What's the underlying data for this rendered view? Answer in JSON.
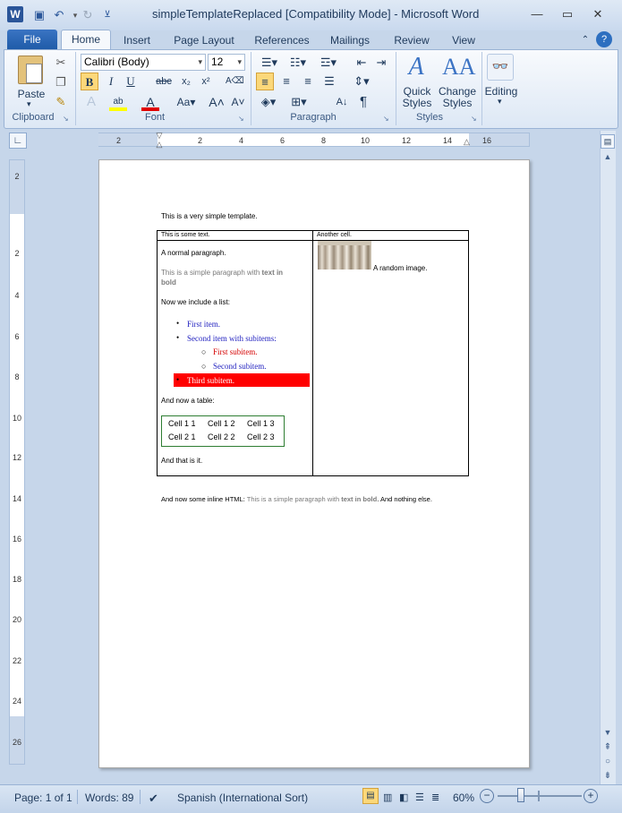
{
  "window": {
    "title": "simpleTemplateReplaced [Compatibility Mode]  -  Microsoft Word",
    "app_icon": "W"
  },
  "tabs": [
    "File",
    "Home",
    "Insert",
    "Page Layout",
    "References",
    "Mailings",
    "Review",
    "View"
  ],
  "ribbon": {
    "clipboard": {
      "paste": "Paste",
      "label": "Clipboard"
    },
    "font": {
      "family": "Calibri (Body)",
      "size": "12",
      "label": "Font"
    },
    "paragraph": {
      "label": "Paragraph"
    },
    "styles": {
      "quick": "Quick",
      "quick2": "Styles",
      "change": "Change",
      "change2": "Styles",
      "label": "Styles"
    },
    "editing": {
      "label": "Editing"
    }
  },
  "ruler": {
    "h_ticks": [
      "2",
      "2",
      "4",
      "6",
      "8",
      "10",
      "12",
      "14",
      "16"
    ],
    "v_ticks": [
      "2",
      "2",
      "4",
      "6",
      "8",
      "10",
      "12",
      "14",
      "16",
      "18",
      "20",
      "22",
      "24",
      "26"
    ]
  },
  "document": {
    "intro": "This is a very simple template.",
    "table": {
      "header_left": "This is some text.",
      "header_right": "Another cell.",
      "normal_paragraph": "A normal paragraph.",
      "simple_para_pre": "This is a simple paragraph with ",
      "simple_para_bold1": "text in",
      "simple_para_bold2": "bold",
      "list_intro": "Now we include a list:",
      "list": {
        "first": "First item.",
        "second": "Second item with subitems:",
        "sub1": "First subitem.",
        "sub2": "Second subitem.",
        "third": "Third subitem."
      },
      "table_intro": "And now a table:",
      "inner_table": [
        [
          "Cell 1 1",
          "Cell 1 2",
          "Cell 1 3"
        ],
        [
          "Cell 2 1",
          "Cell 2 2",
          "Cell 2 3"
        ]
      ],
      "end": "And that is it.",
      "image_caption": "A random image."
    },
    "inline_html": {
      "pre": "And now some inline HTML: ",
      "gray": "This is a simple paragraph with ",
      "bold": "text in bold",
      "post": ".  And nothing else."
    }
  },
  "status": {
    "page": "Page: 1 of 1",
    "words": "Words: 89",
    "language": "Spanish (International Sort)",
    "zoom": "60%"
  },
  "colors": {
    "list_blue": "#1f1fbf",
    "list_red": "#d40000",
    "highlight_red": "#ff0000",
    "inner_table_border": "#2e7d32",
    "gray_text": "#7a7a7a"
  }
}
